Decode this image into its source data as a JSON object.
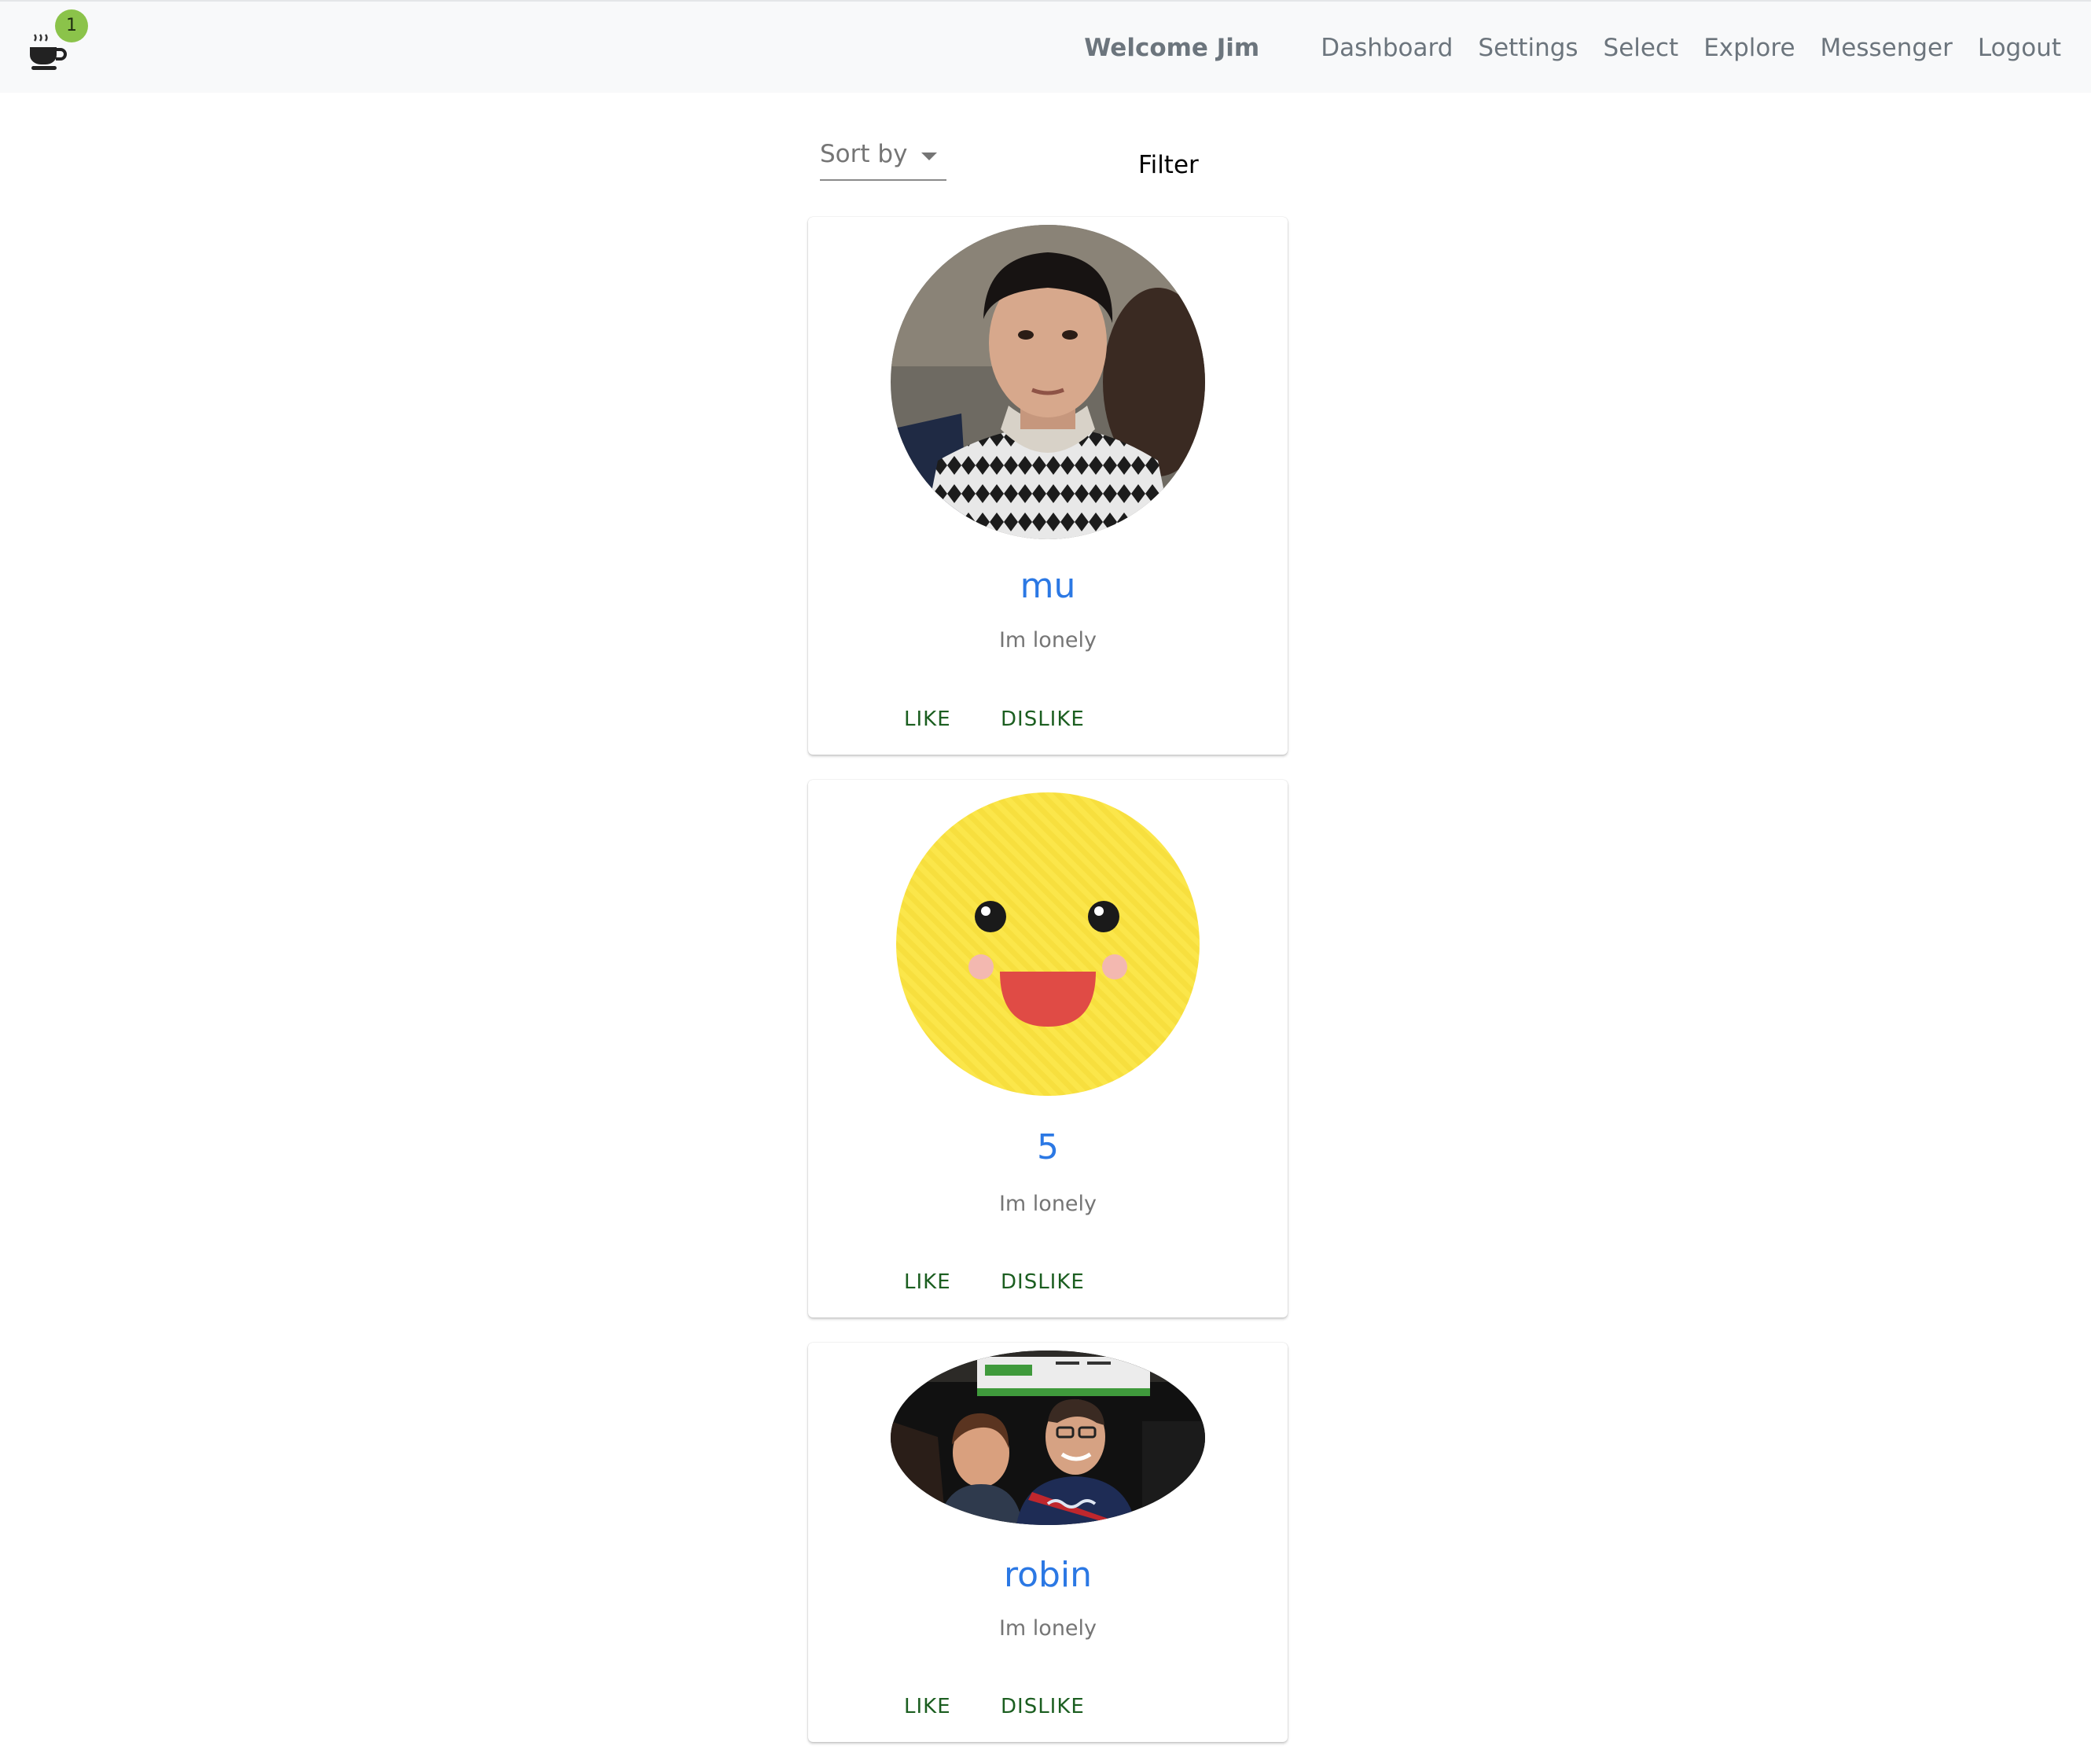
{
  "navbar": {
    "badge_count": "1",
    "brand_icon": "coffee-cup-icon",
    "welcome": "Welcome Jim",
    "links": [
      "Dashboard",
      "Settings",
      "Select",
      "Explore",
      "Messenger",
      "Logout"
    ]
  },
  "toolbar": {
    "sort_label": "Sort by",
    "filter_label": "Filter"
  },
  "profiles": [
    {
      "name": "mu",
      "bio": "Im lonely",
      "like": "LIKE",
      "dislike": "DISLIKE"
    },
    {
      "name": "5",
      "bio": "Im lonely",
      "like": "LIKE",
      "dislike": "DISLIKE"
    },
    {
      "name": "robin",
      "bio": "Im lonely",
      "like": "LIKE",
      "dislike": "DISLIKE"
    }
  ],
  "colors": {
    "badge": "#8bc34a",
    "name_link": "#2b78e4",
    "action_button": "#1b5e20",
    "navbar_bg": "#f8f9fa"
  }
}
